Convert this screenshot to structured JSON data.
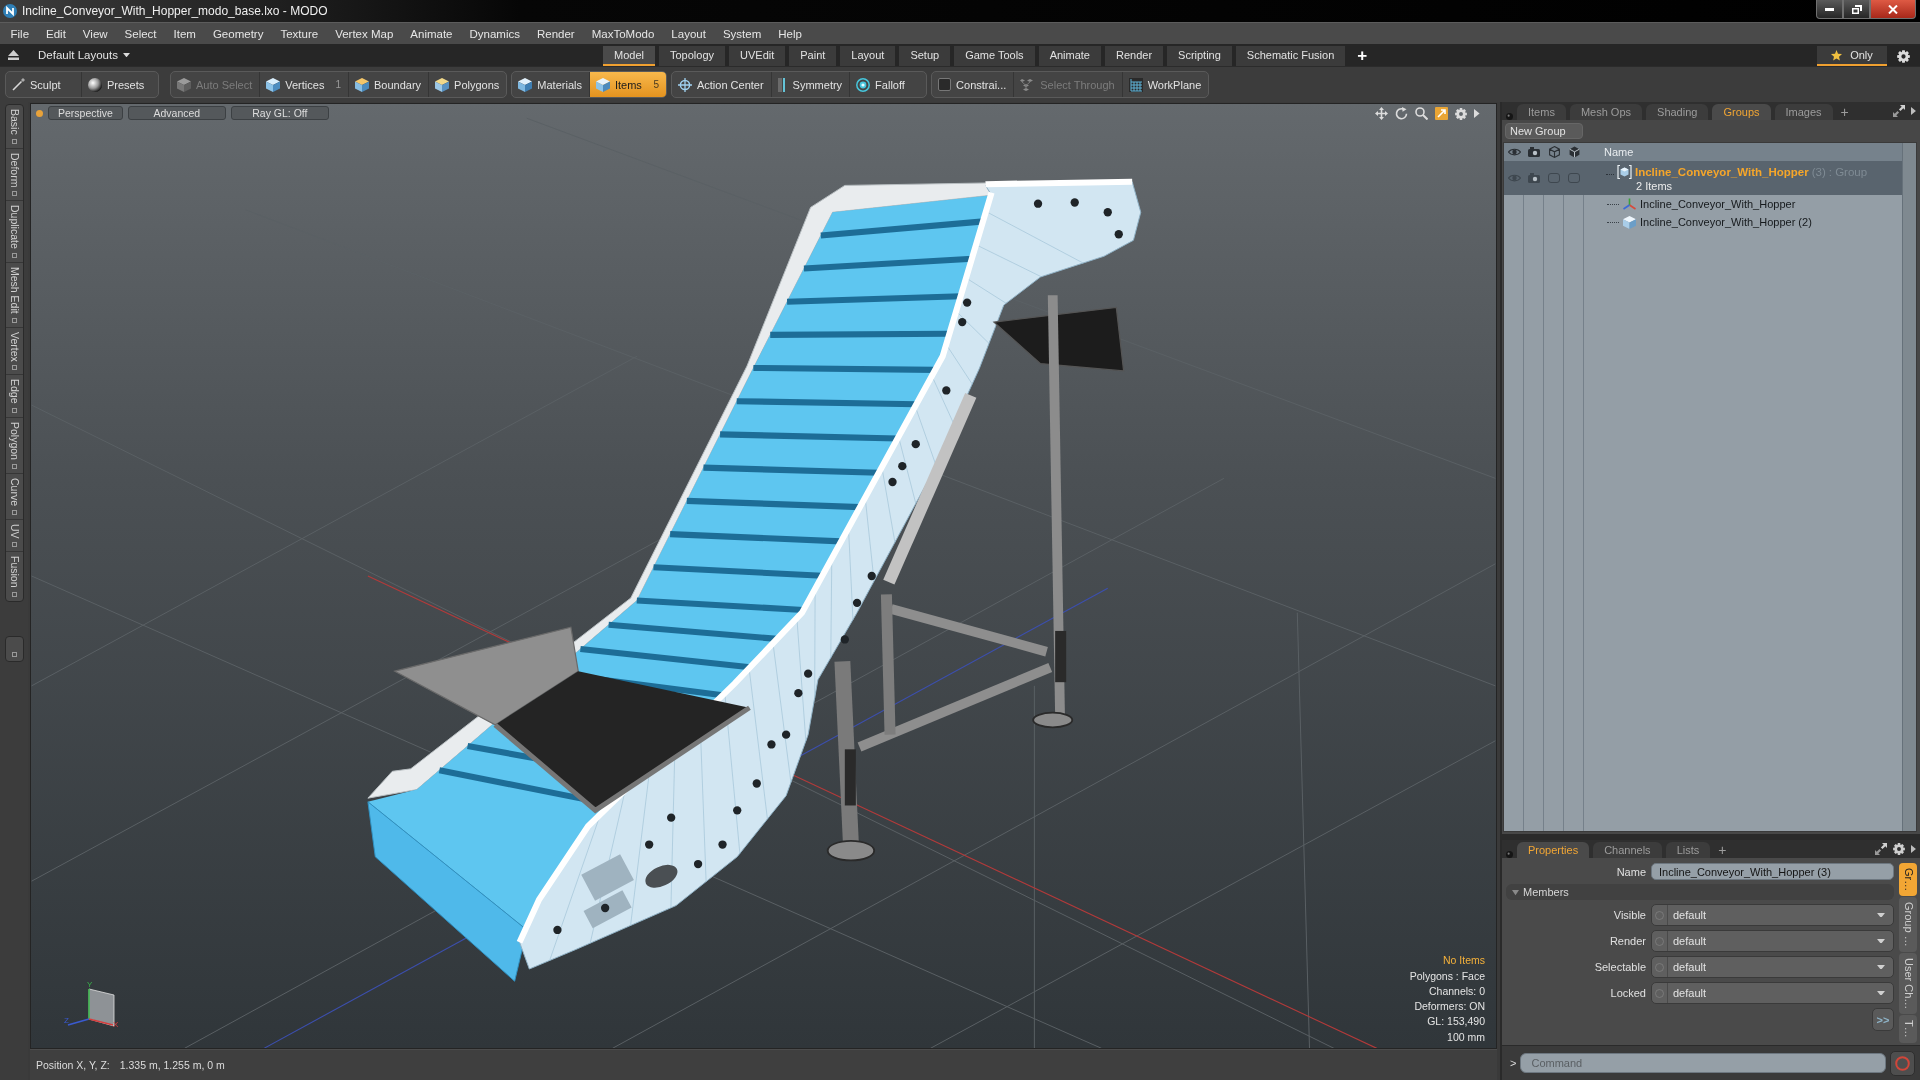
{
  "window": {
    "title": "Incline_Conveyor_With_Hopper_modo_base.lxo - MODO"
  },
  "menu": [
    "File",
    "Edit",
    "View",
    "Select",
    "Item",
    "Geometry",
    "Texture",
    "Vertex Map",
    "Animate",
    "Dynamics",
    "Render",
    "MaxToModo",
    "Layout",
    "System",
    "Help"
  ],
  "layout_bar": {
    "layout_menu": "Default Layouts",
    "tabs": [
      {
        "label": "Model",
        "selected": true
      },
      {
        "label": "Topology",
        "selected": false
      },
      {
        "label": "UVEdit",
        "selected": false
      },
      {
        "label": "Paint",
        "selected": false
      },
      {
        "label": "Layout",
        "selected": false
      },
      {
        "label": "Setup",
        "selected": false
      },
      {
        "label": "Game Tools",
        "selected": false
      },
      {
        "label": "Animate",
        "selected": false
      },
      {
        "label": "Render",
        "selected": false
      },
      {
        "label": "Scripting",
        "selected": false
      },
      {
        "label": "Schematic Fusion",
        "selected": false
      }
    ],
    "add": "+",
    "only": {
      "label": "Only",
      "selected": true
    }
  },
  "toolbar": [
    {
      "items": [
        {
          "label": "Sculpt",
          "kind": "sculpt",
          "selected": false,
          "disabled": false
        },
        {
          "label": "Presets",
          "kind": "presets",
          "selected": false,
          "disabled": false
        }
      ]
    },
    {
      "items": [
        {
          "label": "Auto Select",
          "kind": "autoselect",
          "selected": false,
          "disabled": true
        },
        {
          "label": "Vertices",
          "kind": "vertices",
          "count": "1",
          "selected": false,
          "disabled": false
        },
        {
          "label": "Boundary",
          "kind": "boundary",
          "selected": false,
          "disabled": false
        },
        {
          "label": "Polygons",
          "kind": "polygons",
          "selected": false,
          "disabled": false
        }
      ]
    },
    {
      "items": [
        {
          "label": "Materials",
          "kind": "materials",
          "selected": false,
          "disabled": false
        },
        {
          "label": "Items",
          "kind": "items",
          "count": "5",
          "selected": true,
          "disabled": false
        }
      ]
    },
    {
      "items": [
        {
          "label": "Action Center",
          "kind": "actioncenter",
          "selected": false,
          "disabled": false
        },
        {
          "label": "Symmetry",
          "kind": "symmetry",
          "selected": false,
          "disabled": false
        },
        {
          "label": "Falloff",
          "kind": "falloff",
          "selected": false,
          "disabled": false
        }
      ]
    },
    {
      "items": [
        {
          "label": "Constrai...",
          "kind": "constraints",
          "selected": false,
          "disabled": false
        },
        {
          "label": "Select Through",
          "kind": "selectthrough",
          "selected": false,
          "disabled": true
        },
        {
          "label": "WorkPlane",
          "kind": "workplane",
          "selected": false,
          "disabled": false
        }
      ]
    }
  ],
  "side_tabs": [
    "Basic",
    "Deform",
    "Duplicate",
    "Mesh Edit",
    "Vertex",
    "Edge",
    "Polygon",
    "Curve",
    "UV",
    "Fusion"
  ],
  "viewport": {
    "view_buttons": [
      "Perspective",
      "Advanced",
      "Ray GL: Off"
    ],
    "axis_labels": [
      "Y",
      "Z",
      "X"
    ],
    "stats": [
      {
        "text": "No Items",
        "highlight": true
      },
      {
        "text": "Polygons : Face",
        "highlight": false
      },
      {
        "text": "Channels: 0",
        "highlight": false
      },
      {
        "text": "Deformers: ON",
        "highlight": false
      },
      {
        "text": "GL: 153,490",
        "highlight": false
      },
      {
        "text": "100 mm",
        "highlight": false
      }
    ]
  },
  "status_bar": {
    "label": "Position X, Y, Z:",
    "value": "1.335 m, 1.255 m, 0 m"
  },
  "items_panel": {
    "tabs": [
      {
        "label": "Items",
        "selected": false
      },
      {
        "label": "Mesh Ops",
        "selected": false
      },
      {
        "label": "Shading",
        "selected": false
      },
      {
        "label": "Groups",
        "selected": true
      },
      {
        "label": "Images",
        "selected": false
      }
    ],
    "add": "+",
    "new_group": "New Group",
    "name_column": "Name",
    "groups": [
      {
        "name": "Incline_Conveyor_With_Hopper",
        "index": "(3)",
        "type": ": Group",
        "count": "2 Items",
        "selected": true,
        "visible": true,
        "render": true,
        "selectable": false,
        "locked": false,
        "children": [
          {
            "name": "Incline_Conveyor_With_Hopper",
            "kind": "locator"
          },
          {
            "name": "Incline_Conveyor_With_Hopper (2)",
            "kind": "mesh"
          }
        ]
      }
    ]
  },
  "properties_panel": {
    "tabs": [
      {
        "label": "Properties",
        "selected": true
      },
      {
        "label": "Channels",
        "selected": false
      },
      {
        "label": "Lists",
        "selected": false
      }
    ],
    "add": "+",
    "name_label": "Name",
    "name_value": "Incline_Conveyor_With_Hopper (3)",
    "section": {
      "title": "Members",
      "expanded": true
    },
    "fields": [
      {
        "label": "Visible",
        "value": "default"
      },
      {
        "label": "Render",
        "value": "default"
      },
      {
        "label": "Selectable",
        "value": "default"
      },
      {
        "label": "Locked",
        "value": "default"
      }
    ],
    "more": ">>",
    "side_tabs": [
      {
        "label": "Gr…",
        "selected": true
      },
      {
        "label": "Group …",
        "selected": false
      },
      {
        "label": "User Ch…",
        "selected": false
      },
      {
        "label": "T…",
        "selected": false
      }
    ]
  },
  "command": {
    "prompt": ">",
    "placeholder": "Command"
  }
}
